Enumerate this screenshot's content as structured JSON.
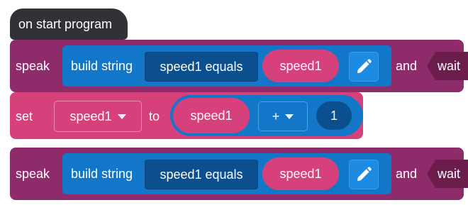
{
  "hat": {
    "label": "on start program"
  },
  "speak_blocks": [
    {
      "label": "speak",
      "build_label": "build string",
      "text_value": "speed1 equals",
      "variable": "speed1",
      "and_label": "and",
      "wait_label": "wait",
      "edit_icon": "pencil-icon"
    },
    {
      "label": "speak",
      "build_label": "build string",
      "text_value": "speed1 equals",
      "variable": "speed1",
      "and_label": "and",
      "wait_label": "wait",
      "edit_icon": "pencil-icon"
    }
  ],
  "set_block": {
    "label": "set",
    "variable": "speed1",
    "to_label": "to",
    "math_variable": "speed1",
    "operator": "+",
    "number": "1"
  },
  "colors": {
    "hat": "#303237",
    "speak": "#8e2b6a",
    "build_string": "#1277c9",
    "text_pill": "#0c4f8f",
    "variable": "#d7417b",
    "wait": "#6b1e4c"
  }
}
